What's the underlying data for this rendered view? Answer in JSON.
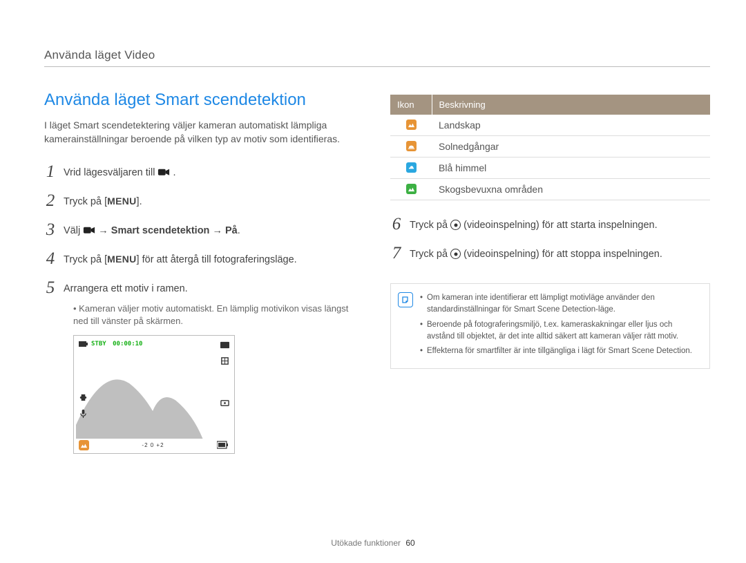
{
  "header": {
    "section": "Använda läget Video"
  },
  "title": "Använda läget Smart scendetektion",
  "intro": "I läget Smart scendetektering väljer kameran automatiskt lämpliga kamerainställningar beroende på vilken typ av motiv som identifieras.",
  "steps": {
    "s1a": "Vrid lägesväljaren till ",
    "s1b": ".",
    "s2a": "Tryck på [",
    "s2m": "MENU",
    "s2b": "].",
    "s3a": "Välj ",
    "s3b": " → ",
    "s3c": "Smart scendetektion",
    "s3d": " → ",
    "s3e": "På",
    "s3f": ".",
    "s4a": "Tryck på [",
    "s4m": "MENU",
    "s4b": "] för att återgå till fotograferingsläge.",
    "s5": "Arrangera ett motiv i ramen.",
    "s5sub": "Kameran väljer motiv automatiskt. En lämplig motivikon visas längst ned till vänster på skärmen.",
    "s6a": "Tryck på ",
    "s6b": " (videoinspelning) för att starta inspelningen.",
    "s7a": "Tryck på ",
    "s7b": " (videoinspelning) för att stoppa inspelningen."
  },
  "preview": {
    "stby": "STBY",
    "time": "00:00:10",
    "ev": "-2   0   +2"
  },
  "table": {
    "h1": "Ikon",
    "h2": "Beskrivning",
    "r1": "Landskap",
    "r2": "Solnedgångar",
    "r3": "Blå himmel",
    "r4": "Skogsbevuxna områden"
  },
  "notes": {
    "n1": "Om kameran inte identifierar ett lämpligt motivläge använder den standardinställningar för Smart Scene Detection-läge.",
    "n2": "Beroende på fotograferingsmiljö, t.ex. kameraskakningar eller ljus och avstånd till objektet, är det inte alltid säkert att kameran väljer rätt motiv.",
    "n3": "Effekterna för smartfilter är inte tillgängliga i lägt för Smart Scene Detection."
  },
  "footer": {
    "label": "Utökade funktioner",
    "page": "60"
  }
}
